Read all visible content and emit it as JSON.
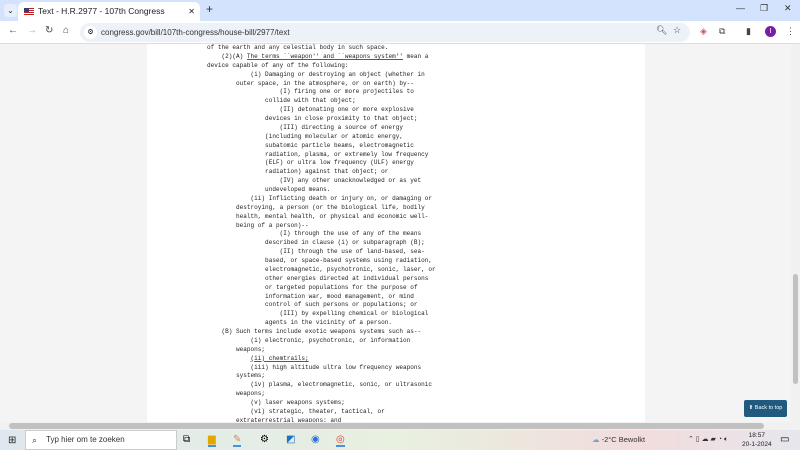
{
  "browser": {
    "tab_title": "Text - H.R.2977 - 107th Congress",
    "url": "congress.gov/bill/107th-congress/house-bill/2977/text",
    "new_tab": "+",
    "avatar": "I"
  },
  "document": {
    "lines": [
      "of the earth and any celestial body in such space.",
      "    (2)(A) The terms ``weapon'' and ``weapons system'' mean a",
      "device capable of any of the following:",
      "            (i) Damaging or destroying an object (whether in",
      "        outer space, in the atmosphere, or on earth) by--",
      "                    (I) firing one or more projectiles to",
      "                collide with that object;",
      "                    (II) detonating one or more explosive",
      "                devices in close proximity to that object;",
      "                    (III) directing a source of energy",
      "                (including molecular or atomic energy,",
      "                subatomic particle beams, electromagnetic",
      "                radiation, plasma, or extremely low frequency",
      "                (ELF) or ultra low frequency (ULF) energy",
      "                radiation) against that object; or",
      "                    (IV) any other unacknowledged or as yet",
      "                undeveloped means.",
      "            (ii) Inflicting death or injury on, or damaging or",
      "        destroying, a person (or the biological life, bodily",
      "        health, mental health, or physical and economic well-",
      "        being of a person)--",
      "                    (I) through the use of any of the means",
      "                described in clause (i) or subparagraph (B);",
      "                    (II) through the use of land-based, sea-",
      "                based, or space-based systems using radiation,",
      "                electromagnetic, psychotronic, sonic, laser, or",
      "                other energies directed at individual persons",
      "                or targeted populations for the purpose of",
      "                information war, mood management, or mind",
      "                control of such persons or populations; or",
      "                    (III) by expelling chemical or biological",
      "                agents in the vicinity of a person.",
      "    (B) Such terms include exotic weapons systems such as--",
      "            (i) electronic, psychotronic, or information",
      "        weapons;",
      "            (ii) chemtrails;",
      "            (iii) high altitude ultra low frequency weapons",
      "        systems;",
      "            (iv) plasma, electromagnetic, sonic, or ultrasonic",
      "        weapons;",
      "            (v) laser weapons systems;",
      "            (vi) strategic, theater, tactical, or",
      "        extraterrestrial weapons; and"
    ],
    "highlights": [
      {
        "line": 1,
        "text": "The terms ``weapon'' and ``weapons system''"
      },
      {
        "line": 35,
        "text": "(ii) chemtrails;"
      }
    ],
    "highlight_color": "#dd2222",
    "back_to_top": "⬆ Back to top"
  },
  "taskbar": {
    "search_placeholder": "Typ hier om te zoeken",
    "weather": "-2°C  Bewolkt",
    "time": "18:57",
    "date": "20-1-2024"
  }
}
